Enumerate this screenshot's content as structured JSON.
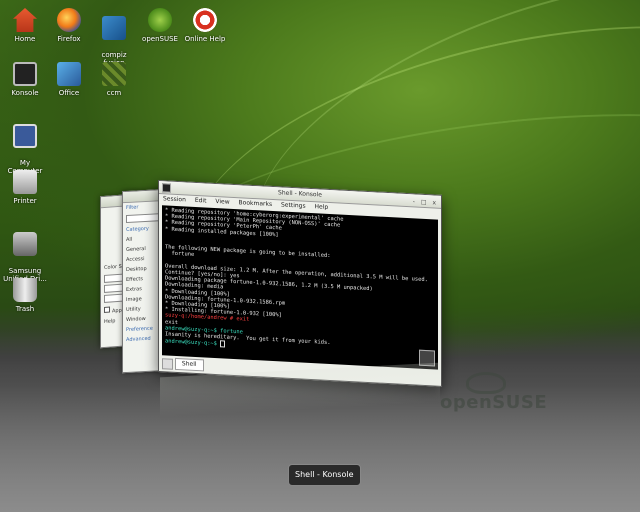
{
  "desktop": {
    "icons": [
      {
        "label": "Home"
      },
      {
        "label": "Firefox"
      },
      {
        "label": "compiz\nfusion"
      },
      {
        "label": "openSUSE"
      },
      {
        "label": "Online Help"
      },
      {
        "label": "Konsole"
      },
      {
        "label": "Office"
      },
      {
        "label": "ccm"
      },
      {
        "label": "My\nComputer"
      },
      {
        "label": "Printer"
      },
      {
        "label": "Samsung\nUnified Dri..."
      },
      {
        "label": "Trash"
      }
    ]
  },
  "back_windows": {
    "panel1": {
      "rows": [
        "Color Sc",
        "Apply",
        "Help"
      ]
    },
    "panel2": {
      "rows": [
        "Filter",
        "Category",
        "All",
        "General",
        "Accessi",
        "Desktop",
        "Effects",
        "Extras",
        "Image",
        "Utility",
        "Window",
        "Preference",
        "Advanced"
      ]
    }
  },
  "konsole": {
    "title": "Shell - Konsole",
    "window_buttons": "- □ x",
    "menu": [
      "Session",
      "Edit",
      "View",
      "Bookmarks",
      "Settings",
      "Help"
    ],
    "terminal_lines": [
      {
        "text": "* Reading repository 'home:cyberorg:experimental' cache",
        "cls": ""
      },
      {
        "text": "* Reading repository 'Main Repository (NON-OSS)' cache",
        "cls": ""
      },
      {
        "text": "* Reading repository 'PeterPh' cache",
        "cls": ""
      },
      {
        "text": "* Reading installed packages [100%]",
        "cls": ""
      },
      {
        "text": "",
        "cls": ""
      },
      {
        "text": "",
        "cls": ""
      },
      {
        "text": "The following NEW package is going to be installed:",
        "cls": ""
      },
      {
        "text": "  fortune",
        "cls": ""
      },
      {
        "text": "",
        "cls": ""
      },
      {
        "text": "Overall download size: 1.2 M. After the operation, additional 3.5 M will be used.",
        "cls": ""
      },
      {
        "text": "Continue? [yes/no]: yes",
        "cls": ""
      },
      {
        "text": "Downloading package fortune-1.0-932.1586, 1.2 M (3.5 M unpacked)",
        "cls": ""
      },
      {
        "text": "Downloading: media",
        "cls": ""
      },
      {
        "text": "* Downloading [100%]",
        "cls": ""
      },
      {
        "text": "Downloading: fortune-1.0-932.1586.rpm",
        "cls": ""
      },
      {
        "text": "* Downloading [100%]",
        "cls": ""
      },
      {
        "text": "* Installing: fortune-1.0-932 [100%]",
        "cls": ""
      },
      {
        "text": "suzy-q:/home/andrew # exit",
        "cls": "red"
      },
      {
        "text": "exit",
        "cls": ""
      },
      {
        "text": "andrew@suzy-q:~$ fortune",
        "cls": "grn"
      },
      {
        "text": "Insanity is hereditary.  You get it from your kids.",
        "cls": ""
      },
      {
        "text": "andrew@suzy-q:~$ ",
        "cls": "grn"
      }
    ],
    "tab_label": "Shell"
  },
  "watermark": {
    "text": "openSUSE"
  },
  "tooltip": {
    "text": "Shell - Konsole"
  }
}
